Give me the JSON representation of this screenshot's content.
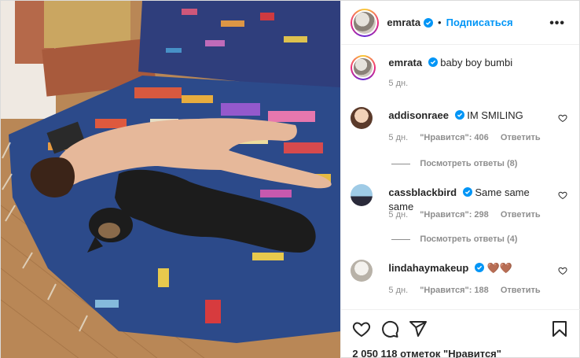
{
  "header": {
    "username": "emrata",
    "separator": "•",
    "follow_label": "Подписаться",
    "more_label": "•••"
  },
  "caption": {
    "username": "emrata",
    "text": "baby boy bumbi",
    "time": "5 дн."
  },
  "comments": [
    {
      "username": "addisonraee",
      "text": "IM SMILING",
      "time": "5 дн.",
      "likes": "\"Нравится\": 406",
      "reply_label": "Ответить",
      "view_replies": "Посмотреть ответы (8)"
    },
    {
      "username": "cassblackbird",
      "text": "Same same same",
      "time": "5 дн.",
      "likes": "\"Нравится\": 298",
      "reply_label": "Ответить",
      "view_replies": "Посмотреть ответы (4)"
    },
    {
      "username": "lindahaymakeup",
      "text": "🤎🤎",
      "time": "5 дн.",
      "likes": "\"Нравится\": 188",
      "reply_label": "Ответить"
    }
  ],
  "footer": {
    "likes_count": "2 050 118 отметок \"Нравится\""
  },
  "icons": {
    "like": "heart-icon",
    "comment": "comment-icon",
    "share": "send-icon",
    "save": "bookmark-icon"
  },
  "colors": {
    "accent": "#0095f6",
    "verified": "#0095f6",
    "text": "#262626",
    "muted": "#8e8e8e"
  }
}
